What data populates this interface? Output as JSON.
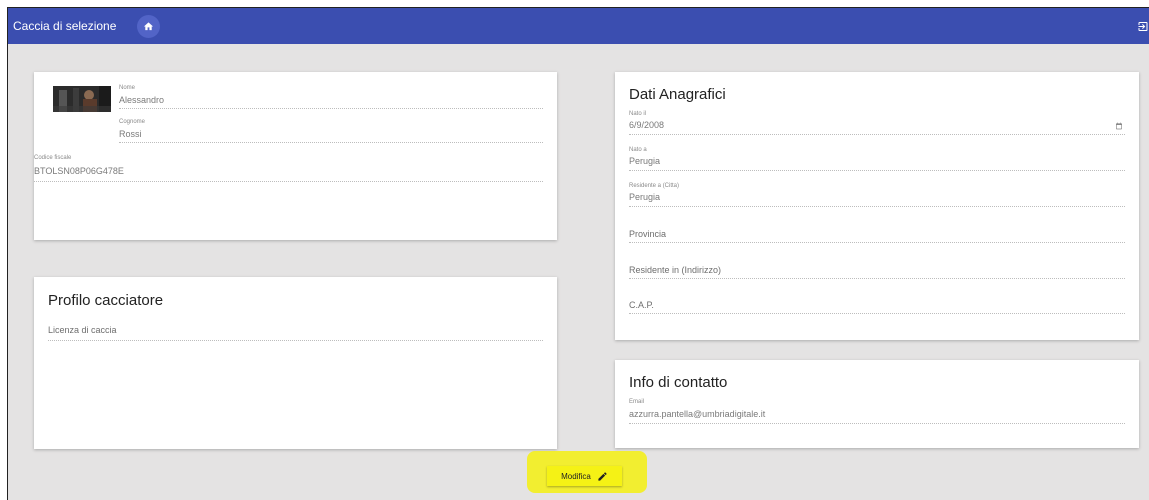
{
  "app": {
    "title": "Caccia di selezione"
  },
  "icons": {
    "home": "home-icon",
    "logout": "logout-icon",
    "edit": "pencil-icon",
    "calendar": "calendar-icon"
  },
  "colors": {
    "topbar": "#3b4eb0",
    "highlight": "#f2ee26"
  },
  "personal": {
    "nome_label": "Nome",
    "nome_value": "Alessandro",
    "cognome_label": "Cognome",
    "cognome_value": "Rossi",
    "cf_label": "Codice fiscale",
    "cf_value": "BTOLSN08P06G478E"
  },
  "profilo": {
    "title": "Profilo cacciatore",
    "licenza_placeholder": "Licenza di caccia"
  },
  "anagrafici": {
    "title": "Dati Anagrafici",
    "nato_il_label": "Nato il",
    "nato_il_value": "6/9/2008",
    "nato_a_label": "Nato a",
    "nato_a_value": "Perugia",
    "residente_citta_label": "Residente a (Citta)",
    "residente_citta_value": "Perugia",
    "provincia_placeholder": "Provincia",
    "indirizzo_placeholder": "Residente in (Indirizzo)",
    "cap_placeholder": "C.A.P."
  },
  "contatto": {
    "title": "Info di contatto",
    "email_label": "Email",
    "email_value": "azzurra.pantella@umbriadigitale.it"
  },
  "actions": {
    "modifica_label": "Modifica"
  }
}
